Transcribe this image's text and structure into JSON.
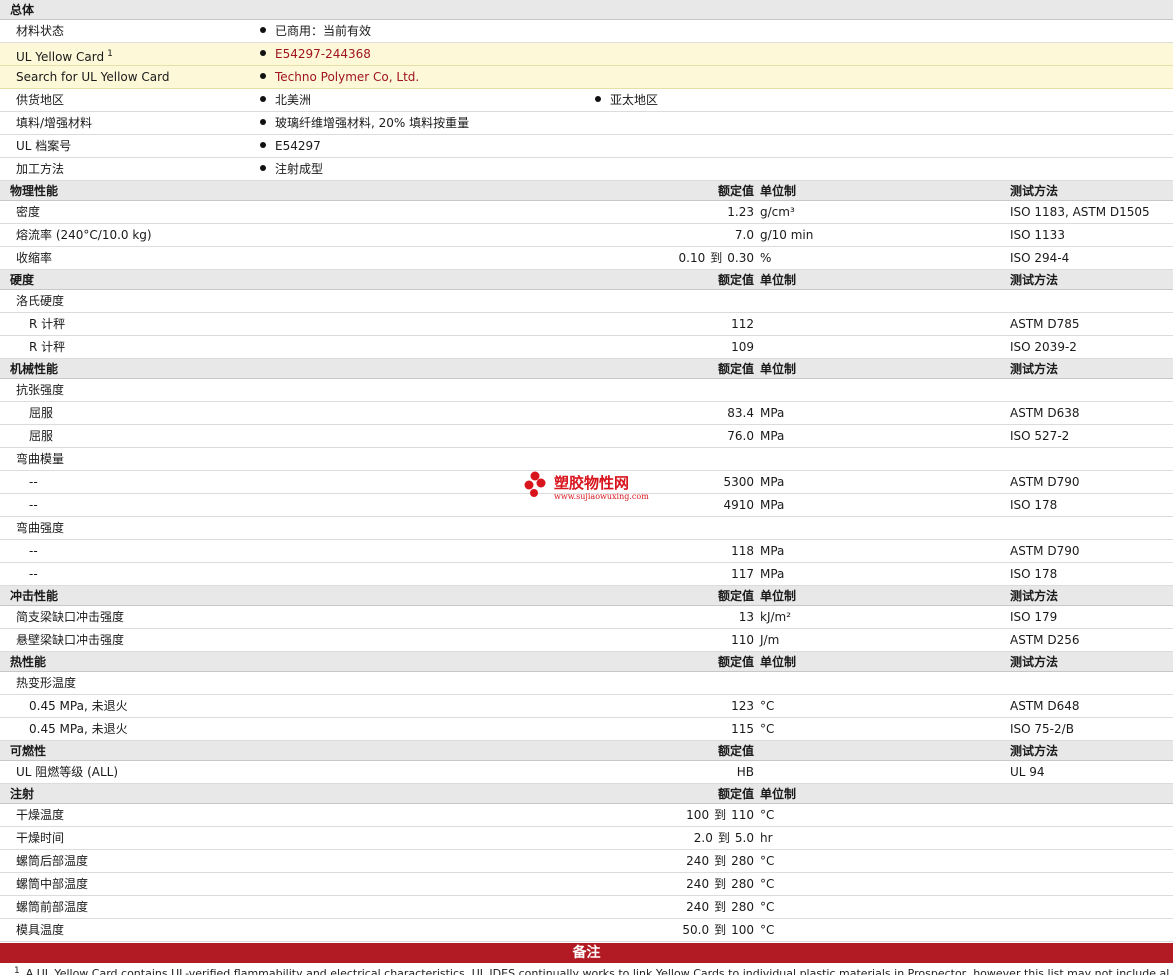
{
  "general": {
    "title": "总体",
    "status_label": "材料状态",
    "status_value": "已商用：当前有效",
    "ulcard_label": "UL Yellow Card",
    "ulcard_sup": "1",
    "ulcard_value": "E54297-244368",
    "search_label": "Search for UL Yellow Card",
    "search_value": "Techno Polymer Co, Ltd.",
    "supply_label": "供货地区",
    "supply_value_1": "北美洲",
    "supply_value_2": "亚太地区",
    "filler_label": "填料/增强材料",
    "filler_value": "玻璃纤维增强材料, 20% 填料按重量",
    "ulfile_label": "UL 档案号",
    "ulfile_value": "E54297",
    "process_label": "加工方法",
    "process_value": "注射成型"
  },
  "headers": {
    "nominal": "额定值",
    "unit": "单位制",
    "method": "测试方法"
  },
  "to_word": "到",
  "physical": {
    "title": "物理性能",
    "density": {
      "label": "密度",
      "value": "1.23",
      "unit": "g/cm³",
      "method": "ISO 1183, ASTM D1505"
    },
    "mfr": {
      "label": "熔流率  (240°C/10.0 kg)",
      "value": "7.0",
      "unit": "g/10 min",
      "method": "ISO 1133"
    },
    "shrink": {
      "label": "收缩率",
      "value_min": "0.10",
      "value_max": "0.30",
      "unit": "%",
      "method": "ISO 294-4"
    }
  },
  "hardness": {
    "title": "硬度",
    "rockwell_label": "洛氏硬度",
    "r1": {
      "label": "R 计秤",
      "value": "112",
      "method": "ASTM D785"
    },
    "r2": {
      "label": "R 计秤",
      "value": "109",
      "method": "ISO 2039-2"
    }
  },
  "mechanical": {
    "title": "机械性能",
    "tensile_label": "抗张强度",
    "t1": {
      "label": "屈服",
      "value": "83.4",
      "unit": "MPa",
      "method": "ASTM D638"
    },
    "t2": {
      "label": "屈服",
      "value": "76.0",
      "unit": "MPa",
      "method": "ISO 527-2"
    },
    "flexmod_label": "弯曲模量",
    "fm1": {
      "label": "--",
      "value": "5300",
      "unit": "MPa",
      "method": "ASTM D790"
    },
    "fm2": {
      "label": "--",
      "value": "4910",
      "unit": "MPa",
      "method": "ISO 178"
    },
    "flexstr_label": "弯曲强度",
    "fs1": {
      "label": "--",
      "value": "118",
      "unit": "MPa",
      "method": "ASTM D790"
    },
    "fs2": {
      "label": "--",
      "value": "117",
      "unit": "MPa",
      "method": "ISO 178"
    }
  },
  "impact": {
    "title": "冲击性能",
    "charpy": {
      "label": "简支梁缺口冲击强度",
      "value": "13",
      "unit": "kJ/m²",
      "method": "ISO 179"
    },
    "izod": {
      "label": "悬壁梁缺口冲击强度",
      "value": "110",
      "unit": "J/m",
      "method": "ASTM D256"
    }
  },
  "thermal": {
    "title": "热性能",
    "hdt_label": "热变形温度",
    "h1": {
      "label": "0.45 MPa, 未退火",
      "value": "123",
      "unit": "°C",
      "method": "ASTM D648"
    },
    "h2": {
      "label": "0.45 MPa, 未退火",
      "value": "115",
      "unit": "°C",
      "method": "ISO 75-2/B"
    }
  },
  "flammability": {
    "title": "可燃性",
    "ul": {
      "label": "UL 阻燃等级  (ALL)",
      "value": "HB",
      "method": "UL 94"
    }
  },
  "injection": {
    "title": "注射",
    "dry_temp": {
      "label": "干燥温度",
      "min": "100",
      "max": "110",
      "unit": "°C"
    },
    "dry_time": {
      "label": "干燥时间",
      "min": "2.0",
      "max": "5.0",
      "unit": "hr"
    },
    "rear": {
      "label": "螺筒后部温度",
      "min": "240",
      "max": "280",
      "unit": "°C"
    },
    "mid": {
      "label": "螺筒中部温度",
      "min": "240",
      "max": "280",
      "unit": "°C"
    },
    "front": {
      "label": "螺筒前部温度",
      "min": "240",
      "max": "280",
      "unit": "°C"
    },
    "mold": {
      "label": "模具温度",
      "min": "50.0",
      "max": "100",
      "unit": "°C"
    }
  },
  "notes": {
    "title": "备注",
    "footnote_num": "1",
    "footnote_text": "A UL Yellow Card contains UL-verified flammability and electrical characteristics. UL IDES continually works to link Yellow Cards to individual plastic materials in Prospector, however this list may not include all of the appropriate links."
  },
  "watermark": {
    "name": "塑胶物性网",
    "url": "www.sujiaowuxing.com",
    "color": "#d8141d"
  }
}
